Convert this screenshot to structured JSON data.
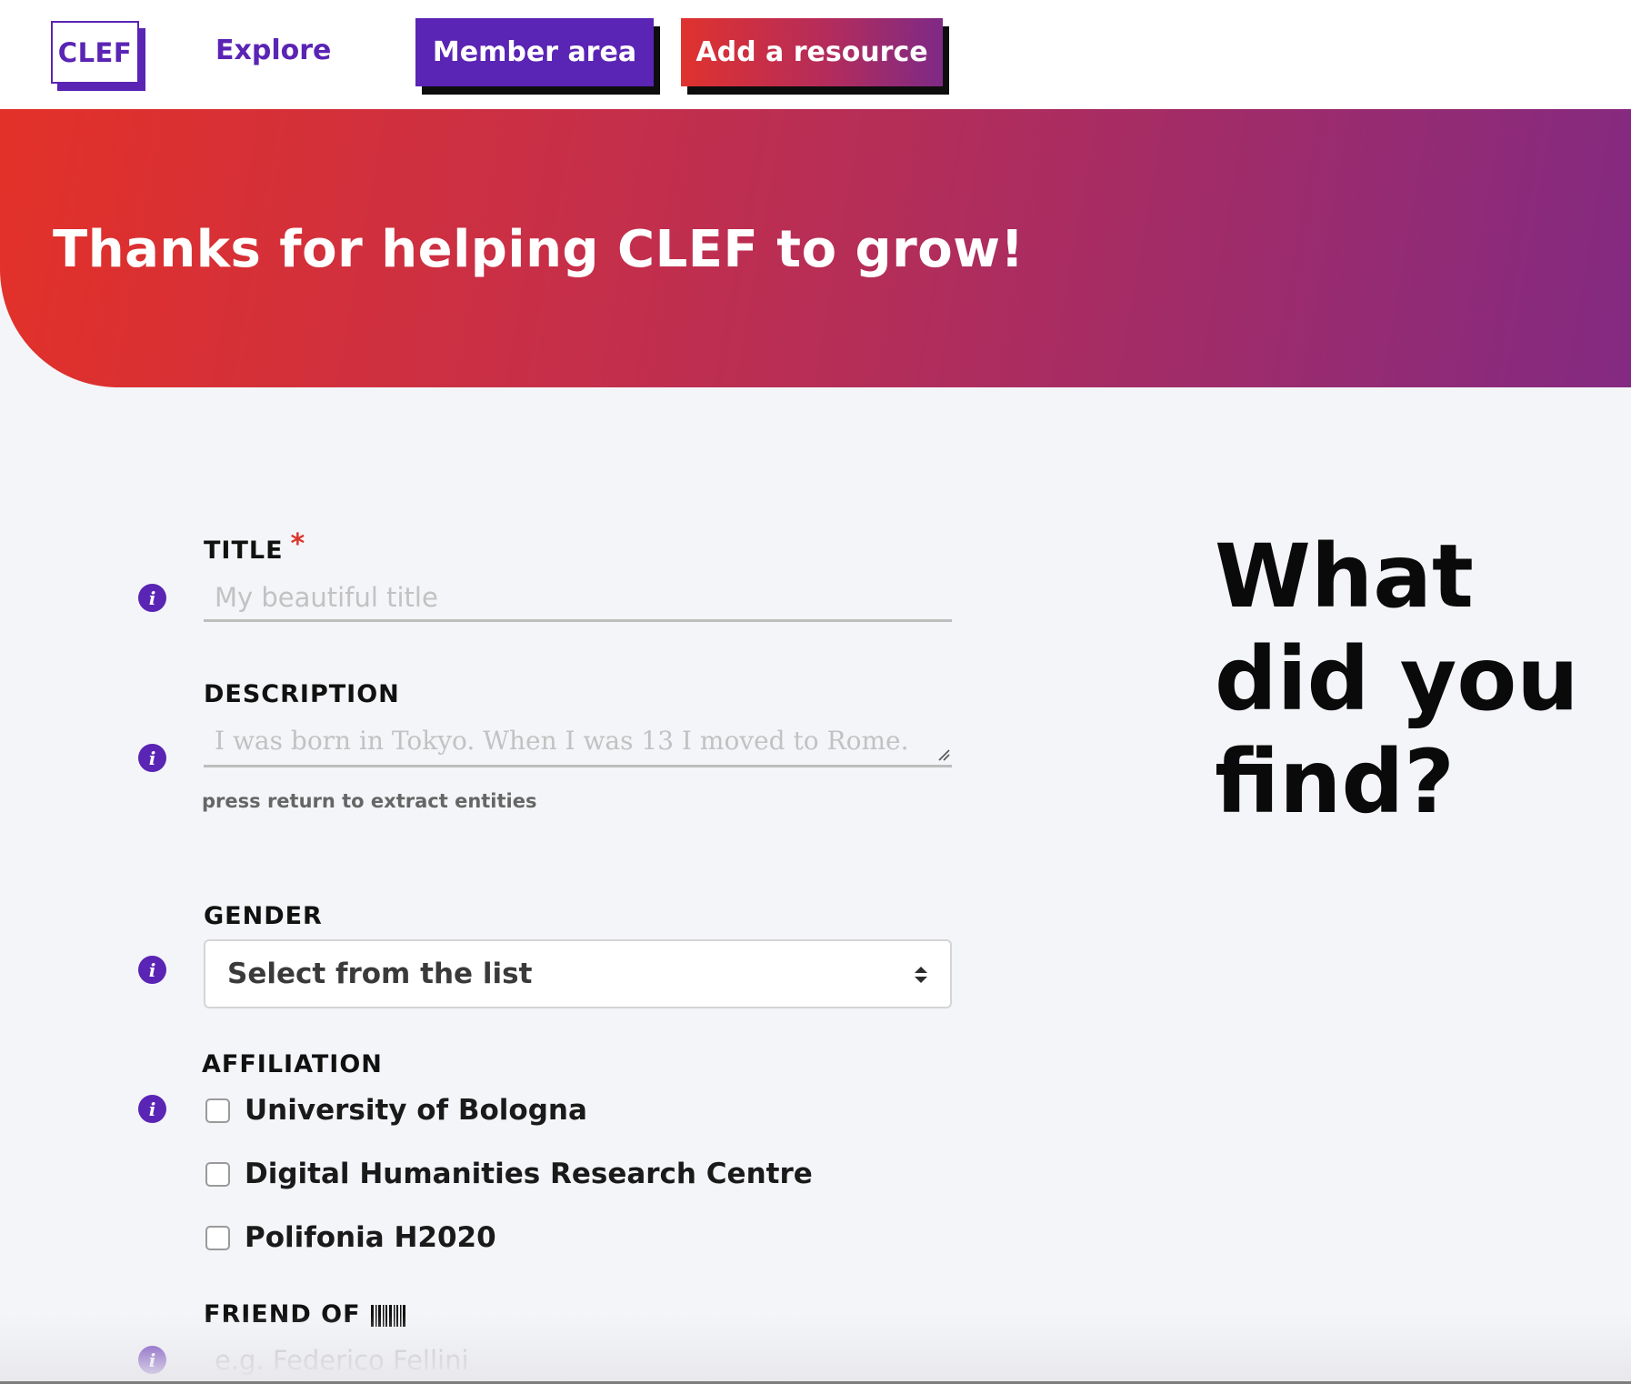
{
  "nav": {
    "logo": "CLEF",
    "explore": "Explore",
    "member_area": "Member area",
    "add_resource": "Add a resource"
  },
  "hero": {
    "title": "Thanks for helping CLEF to grow!"
  },
  "side_heading": "What did you find?",
  "form": {
    "title": {
      "label": "TITLE",
      "required_mark": "*",
      "placeholder": "My beautiful title",
      "value": ""
    },
    "description": {
      "label": "DESCRIPTION",
      "placeholder": "I was born in Tokyo. When I was 13 I moved to Rome.",
      "value": "",
      "helper": "press return to extract entities"
    },
    "gender": {
      "label": "GENDER",
      "selected": "Select from the list"
    },
    "affiliation": {
      "label": "AFFILIATION",
      "options": [
        {
          "label": "University of Bologna",
          "checked": false
        },
        {
          "label": "Digital Humanities Research Centre",
          "checked": false
        },
        {
          "label": "Polifonia H2020",
          "checked": false
        }
      ]
    },
    "friend_of": {
      "label": "FRIEND OF",
      "icon": "barcode-icon",
      "placeholder": "e.g. Federico Fellini",
      "value": ""
    }
  },
  "icons": {
    "info": "info-icon",
    "select_arrows": "sort-arrows-icon",
    "resize": "resize-grip-icon"
  },
  "colors": {
    "brand_purple": "#5a24b4",
    "brand_red": "#e33128",
    "required": "#d9362b",
    "background": "#f4f5f8"
  }
}
